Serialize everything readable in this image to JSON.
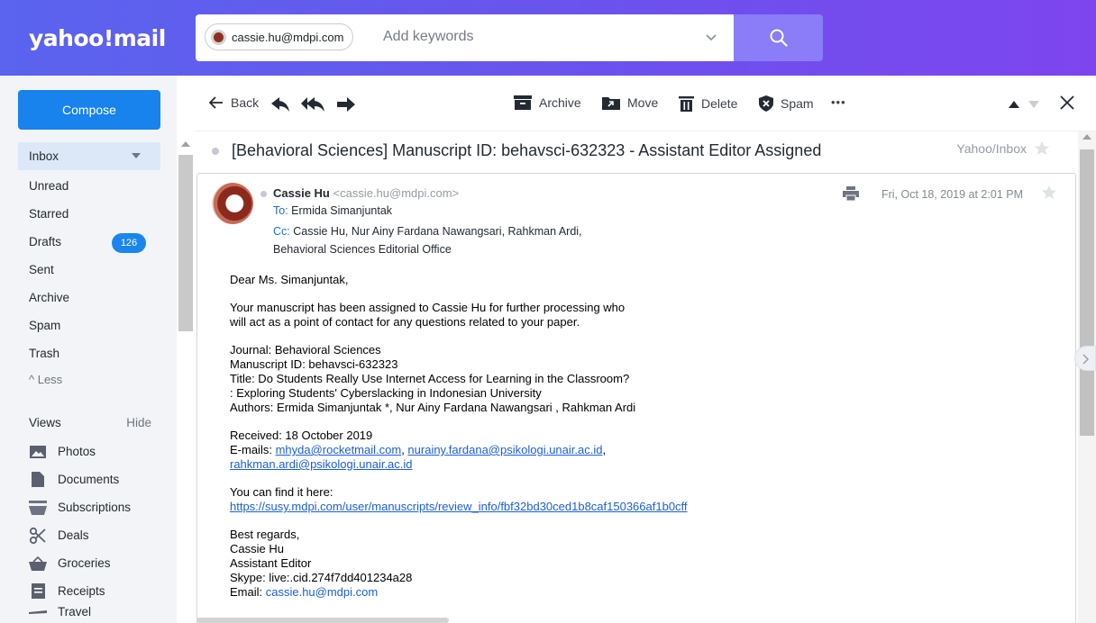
{
  "brand": {
    "logo": "yahoo!mail"
  },
  "search": {
    "chip_label": "cassie.hu@mdpi.com",
    "placeholder": "Add keywords"
  },
  "compose_label": "Compose",
  "folders": [
    {
      "label": "Inbox",
      "selected": true
    },
    {
      "label": "Unread"
    },
    {
      "label": "Starred"
    },
    {
      "label": "Drafts",
      "badge": "126"
    },
    {
      "label": "Sent"
    },
    {
      "label": "Archive"
    },
    {
      "label": "Spam"
    },
    {
      "label": "Trash"
    },
    {
      "label": "^ Less"
    }
  ],
  "views": {
    "title": "Views",
    "hide_label": "Hide",
    "items": [
      {
        "label": "Photos",
        "icon": "photos-icon"
      },
      {
        "label": "Documents",
        "icon": "document-icon"
      },
      {
        "label": "Subscriptions",
        "icon": "subscriptions-icon"
      },
      {
        "label": "Deals",
        "icon": "scissors-icon"
      },
      {
        "label": "Groceries",
        "icon": "basket-icon"
      },
      {
        "label": "Receipts",
        "icon": "receipt-icon"
      },
      {
        "label": "Travel",
        "icon": "plane-icon"
      }
    ]
  },
  "toolbar": {
    "back_label": "Back",
    "archive_label": "Archive",
    "move_label": "Move",
    "delete_label": "Delete",
    "spam_label": "Spam",
    "more_label": "•••"
  },
  "message": {
    "subject": "[Behavioral Sciences] Manuscript ID: behavsci-632323 - Assistant Editor Assigned",
    "folder": "Yahoo/Inbox",
    "from_name": "Cassie Hu",
    "from_email": "<cassie.hu@mdpi.com>",
    "to_label": "To:",
    "to": "Ermida Simanjuntak",
    "cc_label": "Cc:",
    "cc_line1": "Cassie Hu,  Nur Ainy Fardana Nawangsari,  Rahkman Ardi,",
    "cc_line2": "Behavioral Sciences Editorial Office",
    "date": "Fri, Oct 18, 2019 at 2:01 PM",
    "body": {
      "greeting": "Dear Ms. Simanjuntak,",
      "para1_l1": "Your manuscript has been assigned to Cassie Hu for further processing who",
      "para1_l2": "will act as a point of contact for any questions related to your paper.",
      "journal": "Journal: Behavioral Sciences",
      "manuscript_id": "Manuscript ID: behavsci-632323",
      "title_l1": "Title: Do Students Really Use Internet Access for Learning in the Classroom?",
      "title_l2": ": Exploring Students' Cyberslacking in Indonesian University",
      "authors": "Authors: Ermida Simanjuntak *, Nur Ainy Fardana Nawangsari , Rahkman Ardi",
      "received": "Received: 18 October 2019",
      "emails_label": "E-mails: ",
      "email1": "mhyda@rocketmail.com",
      "email_sep": ", ",
      "email2": "nurainy.fardana@psikologi.unair.ac.id",
      "email_trail": ",",
      "email3": "rahkman.ardi@psikologi.unair.ac.id",
      "find_label": "You can find it here:",
      "link": "https://susy.mdpi.com/user/manuscripts/review_info/fbf32bd30ced1b8caf150366af1b0cff",
      "regards": "Best regards,",
      "sig_name": "Cassie Hu",
      "sig_role": "Assistant Editor",
      "skype": "Skype: live:.cid.274f7dd401234a28",
      "email_sig_label": "Email: ",
      "email_sig": "cassie.hu@mdpi.com"
    }
  }
}
